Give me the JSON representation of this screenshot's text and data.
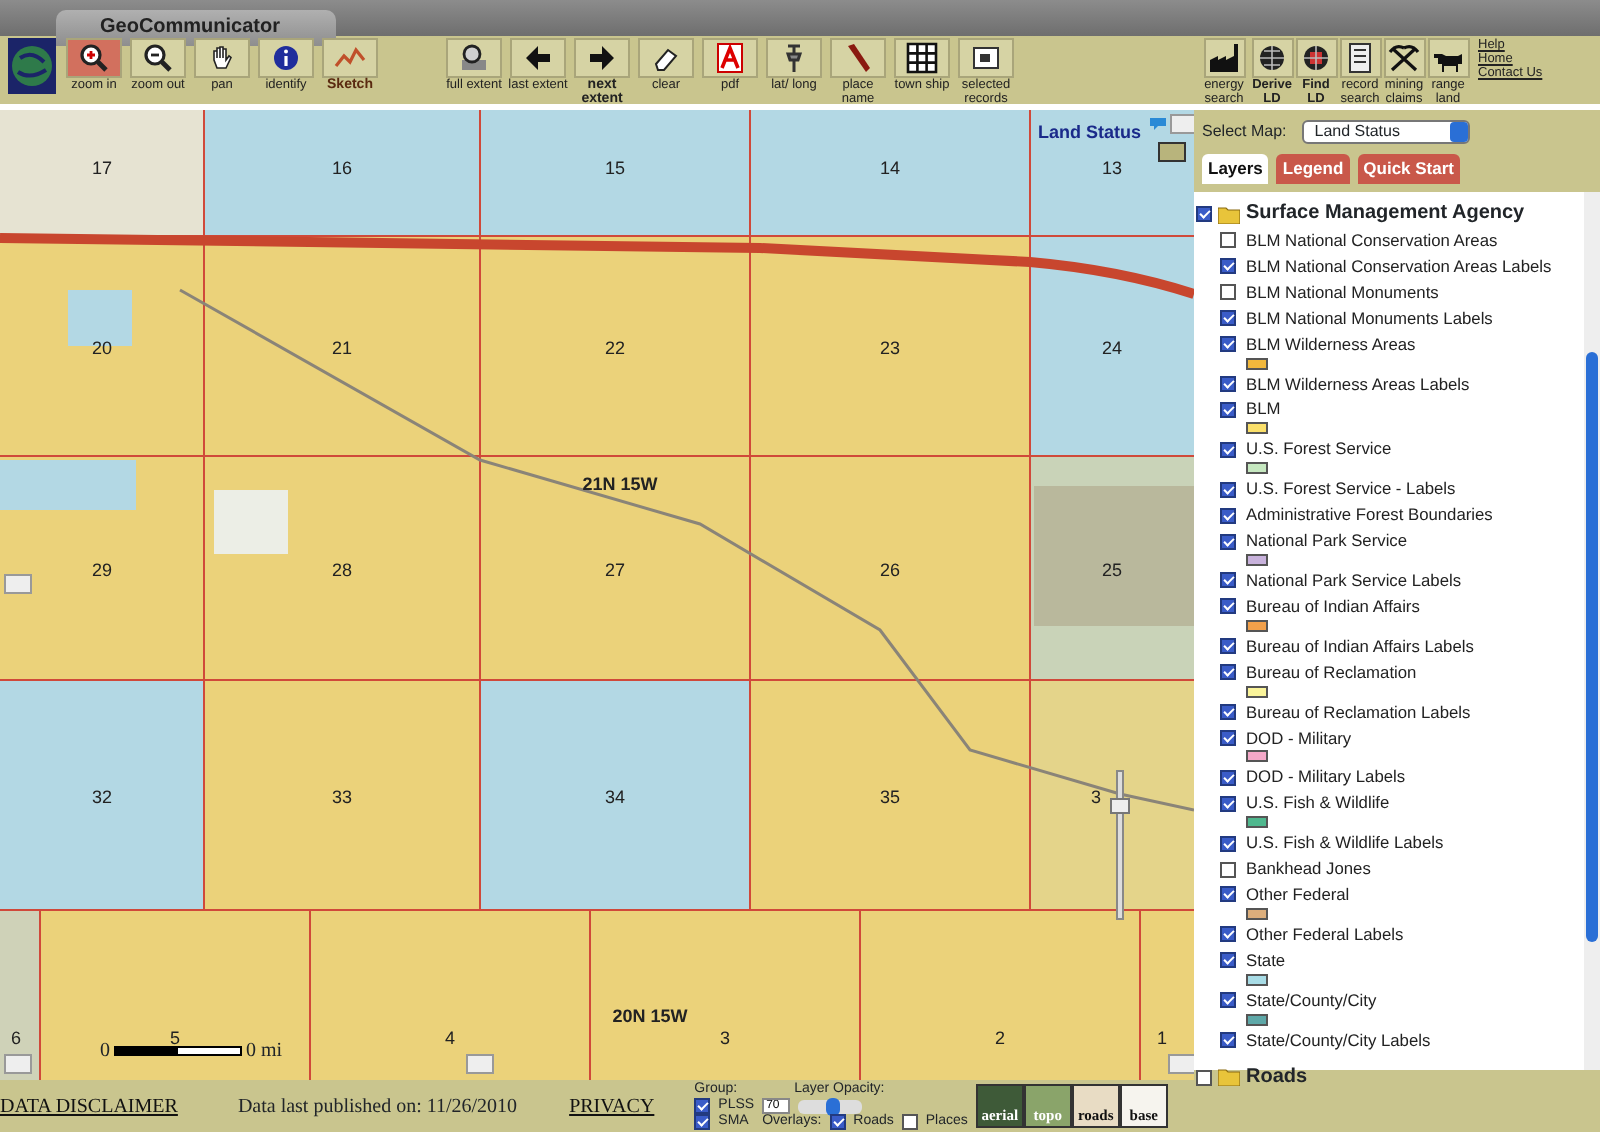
{
  "window": {
    "title": "GeoCommunicator"
  },
  "tool_groups": [
    [
      {
        "label": "zoom in",
        "selected": true,
        "bold": false
      },
      {
        "label": "zoom out",
        "selected": false,
        "bold": false
      },
      {
        "label": "pan",
        "selected": false,
        "bold": false
      },
      {
        "label": "identify",
        "selected": false,
        "bold": false
      },
      {
        "label": "Sketch",
        "selected": false,
        "bold": true
      }
    ],
    [
      {
        "label": "full extent",
        "selected": false,
        "bold": false
      },
      {
        "label": "last extent",
        "selected": false,
        "bold": false
      },
      {
        "label": "next extent",
        "selected": false,
        "bold": true
      },
      {
        "label": "clear",
        "selected": false,
        "bold": false
      },
      {
        "label": "pdf",
        "selected": false,
        "bold": false
      },
      {
        "label": "lat/ long",
        "selected": false,
        "bold": false
      },
      {
        "label": "place name",
        "selected": false,
        "bold": false
      },
      {
        "label": "town ship",
        "selected": false,
        "bold": false
      },
      {
        "label": "selected records",
        "selected": false,
        "bold": false
      }
    ]
  ],
  "search_tools": [
    {
      "label": "energy search",
      "bold": false
    },
    {
      "label": "Derive LD",
      "bold": true
    },
    {
      "label": "Find LD",
      "bold": true
    },
    {
      "label": "record search",
      "bold": false
    },
    {
      "label": "mining claims",
      "bold": false
    },
    {
      "label": "range land",
      "bold": false
    }
  ],
  "links": [
    "Help",
    "Home",
    "Contact Us"
  ],
  "map": {
    "title": "Land Status",
    "section_rows": [
      [
        {
          "label": "17",
          "color": "#e6e3d2"
        },
        {
          "label": "16",
          "color": "#b3d8e4"
        },
        {
          "label": "15",
          "color": "#b3d8e4"
        },
        {
          "label": "14",
          "color": "#b3d8e4"
        },
        {
          "label": "13",
          "color": "#b3d8e4"
        }
      ],
      [
        {
          "label": "20",
          "color": "#ebd27a"
        },
        {
          "label": "21",
          "color": "#ebd27a"
        },
        {
          "label": "22",
          "color": "#ebd27a"
        },
        {
          "label": "23",
          "color": "#ebd27a"
        },
        {
          "label": "24",
          "color": "#b3d8e4"
        }
      ],
      [
        {
          "label": "29",
          "color": "#ebd27a"
        },
        {
          "label": "28",
          "color": "#ebd27a"
        },
        {
          "label": "27",
          "color": "#ebd27a"
        },
        {
          "label": "26",
          "color": "#ebd27a"
        },
        {
          "label": "25",
          "color": "#c9d3b8"
        }
      ],
      [
        {
          "label": "32",
          "color": "#b3d8e4"
        },
        {
          "label": "33",
          "color": "#ebd27a"
        },
        {
          "label": "34",
          "color": "#b3d8e4"
        },
        {
          "label": "35",
          "color": "#ebd27a"
        },
        {
          "label": "3",
          "color": "#e4d48a"
        }
      ],
      [
        {
          "label": "6",
          "color": "#cfd2b8"
        },
        {
          "label": "5",
          "color": "#ebd27a"
        },
        {
          "label": "4",
          "color": "#ebd27a"
        },
        {
          "label": "3",
          "color": "#ebd27a"
        },
        {
          "label": "2",
          "color": "#ebd27a"
        },
        {
          "label": "1",
          "color": "#ebd27a"
        }
      ]
    ],
    "town_labels": [
      "21N 15W",
      "20N 15W"
    ],
    "scale": {
      "start": "0",
      "end": "0 mi"
    },
    "zoom_slider": {
      "level": 0.8
    }
  },
  "select_map": {
    "label": "Select Map:",
    "value": "Land Status"
  },
  "panel_tabs": [
    {
      "label": "Layers",
      "selected": true
    },
    {
      "label": "Legend",
      "selected": false
    },
    {
      "label": "Quick Start",
      "selected": false
    }
  ],
  "layers": [
    {
      "label": "Surface Management Agency",
      "checked": true,
      "children": [
        {
          "label": "BLM National Conservation Areas",
          "checked": false
        },
        {
          "label": "BLM National Conservation Areas Labels",
          "checked": true
        },
        {
          "label": "BLM National Monuments",
          "checked": false
        },
        {
          "label": "BLM National Monuments Labels",
          "checked": true
        },
        {
          "label": "BLM Wilderness Areas",
          "checked": true,
          "color": "#f2b83c"
        },
        {
          "label": "BLM Wilderness Areas Labels",
          "checked": true
        },
        {
          "label": "BLM",
          "checked": true,
          "color": "#fbe06a"
        },
        {
          "label": "U.S. Forest Service",
          "checked": true,
          "color": "#c6e8c0"
        },
        {
          "label": "U.S. Forest Service - Labels",
          "checked": true
        },
        {
          "label": "Administrative Forest Boundaries",
          "checked": true
        },
        {
          "label": "National Park Service",
          "checked": true,
          "color": "#c8b2dc"
        },
        {
          "label": "National Park Service Labels",
          "checked": true
        },
        {
          "label": "Bureau of Indian Affairs",
          "checked": true,
          "color": "#f2a04a"
        },
        {
          "label": "Bureau of Indian Affairs Labels",
          "checked": true
        },
        {
          "label": "Bureau of Reclamation",
          "checked": true,
          "color": "#faf49a"
        },
        {
          "label": "Bureau of Reclamation Labels",
          "checked": true
        },
        {
          "label": "DOD - Military",
          "checked": true,
          "color": "#f4a8c8"
        },
        {
          "label": "DOD - Military Labels",
          "checked": true
        },
        {
          "label": "U.S. Fish & Wildlife",
          "checked": true,
          "color": "#4fb88e"
        },
        {
          "label": "U.S. Fish & Wildlife Labels",
          "checked": true
        },
        {
          "label": "Bankhead Jones",
          "checked": false
        },
        {
          "label": "Other Federal",
          "checked": true,
          "color": "#dcae7c"
        },
        {
          "label": "Other Federal Labels",
          "checked": true
        },
        {
          "label": "State",
          "checked": true,
          "color": "#a8dce6"
        },
        {
          "label": "State/County/City",
          "checked": true,
          "color": "#5ea8a8"
        },
        {
          "label": "State/County/City Labels",
          "checked": true
        }
      ]
    },
    {
      "label": "Roads",
      "checked": false
    }
  ],
  "footer": {
    "disclaimer": "DATA DISCLAIMER",
    "published": "Data last published on: 11/26/2010",
    "privacy": "PRIVACY",
    "group": {
      "label": "Group:",
      "options": [
        {
          "label": "PLSS",
          "checked": true
        },
        {
          "label": "SMA",
          "checked": true
        }
      ]
    },
    "opacity": {
      "label": "Layer Opacity:",
      "value": "70",
      "level": 0.55
    },
    "overlays": {
      "label": "Overlays:",
      "options": [
        {
          "label": "Roads",
          "checked": true
        },
        {
          "label": "Places",
          "checked": false
        }
      ]
    },
    "base_maps": [
      {
        "label": "aerial",
        "color": "#3e5a38"
      },
      {
        "label": "topo",
        "color": "#8aa46a"
      },
      {
        "label": "roads",
        "color": "#e8dcc4"
      },
      {
        "label": "base",
        "color": "#f6f4ee"
      }
    ]
  }
}
